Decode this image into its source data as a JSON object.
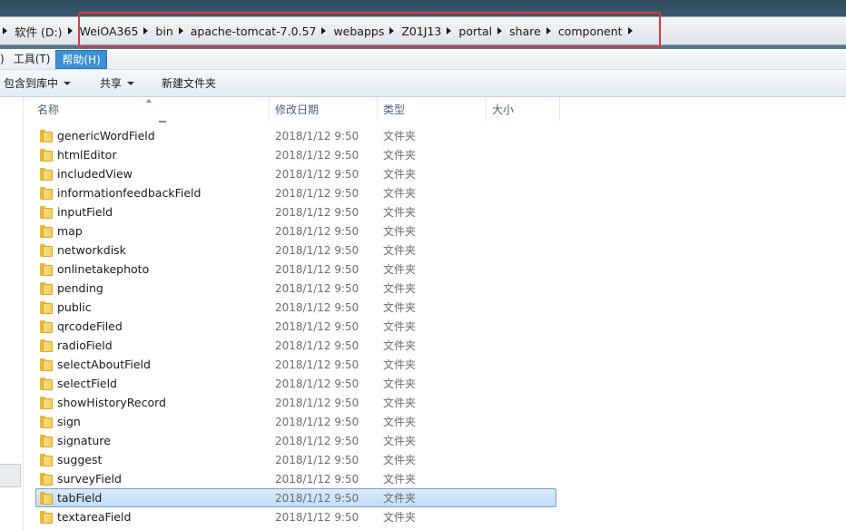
{
  "address": {
    "crumbs": [
      "软件 (D:)",
      "WeiOA365",
      "bin",
      "apache-tomcat-7.0.57",
      "webapps",
      "Z01J13",
      "portal",
      "share",
      "component"
    ]
  },
  "menu": {
    "items": [
      {
        "label": ")",
        "active": false
      },
      {
        "label": "工具(T)",
        "active": false
      },
      {
        "label": "帮助(H)",
        "active": true
      }
    ]
  },
  "toolbar": {
    "include_library": "包含到库中",
    "share": "共享",
    "new_folder": "新建文件夹"
  },
  "columns": {
    "name": "名称",
    "date": "修改日期",
    "type": "类型",
    "size": "大小"
  },
  "files": [
    {
      "name": "genericWordField",
      "date": "2018/1/12 9:50",
      "type": "文件夹"
    },
    {
      "name": "htmlEditor",
      "date": "2018/1/12 9:50",
      "type": "文件夹"
    },
    {
      "name": "includedView",
      "date": "2018/1/12 9:50",
      "type": "文件夹"
    },
    {
      "name": "informationfeedbackField",
      "date": "2018/1/12 9:50",
      "type": "文件夹"
    },
    {
      "name": "inputField",
      "date": "2018/1/12 9:50",
      "type": "文件夹"
    },
    {
      "name": "map",
      "date": "2018/1/12 9:50",
      "type": "文件夹"
    },
    {
      "name": "networkdisk",
      "date": "2018/1/12 9:50",
      "type": "文件夹"
    },
    {
      "name": "onlinetakephoto",
      "date": "2018/1/12 9:50",
      "type": "文件夹"
    },
    {
      "name": "pending",
      "date": "2018/1/12 9:50",
      "type": "文件夹"
    },
    {
      "name": "public",
      "date": "2018/1/12 9:50",
      "type": "文件夹"
    },
    {
      "name": "qrcodeFiled",
      "date": "2018/1/12 9:50",
      "type": "文件夹"
    },
    {
      "name": "radioField",
      "date": "2018/1/12 9:50",
      "type": "文件夹"
    },
    {
      "name": "selectAboutField",
      "date": "2018/1/12 9:50",
      "type": "文件夹"
    },
    {
      "name": "selectField",
      "date": "2018/1/12 9:50",
      "type": "文件夹"
    },
    {
      "name": "showHistoryRecord",
      "date": "2018/1/12 9:50",
      "type": "文件夹"
    },
    {
      "name": "sign",
      "date": "2018/1/12 9:50",
      "type": "文件夹"
    },
    {
      "name": "signature",
      "date": "2018/1/12 9:50",
      "type": "文件夹"
    },
    {
      "name": "suggest",
      "date": "2018/1/12 9:50",
      "type": "文件夹"
    },
    {
      "name": "surveyField",
      "date": "2018/1/12 9:50",
      "type": "文件夹"
    },
    {
      "name": "tabField",
      "date": "2018/1/12 9:50",
      "type": "文件夹",
      "selected": true
    },
    {
      "name": "textareaField",
      "date": "2018/1/12 9:50",
      "type": "文件夹"
    }
  ],
  "colors": {
    "highlight_box": "#e0373a",
    "selection": "#c1dcf9",
    "menu_active": "#3d8fd6"
  }
}
